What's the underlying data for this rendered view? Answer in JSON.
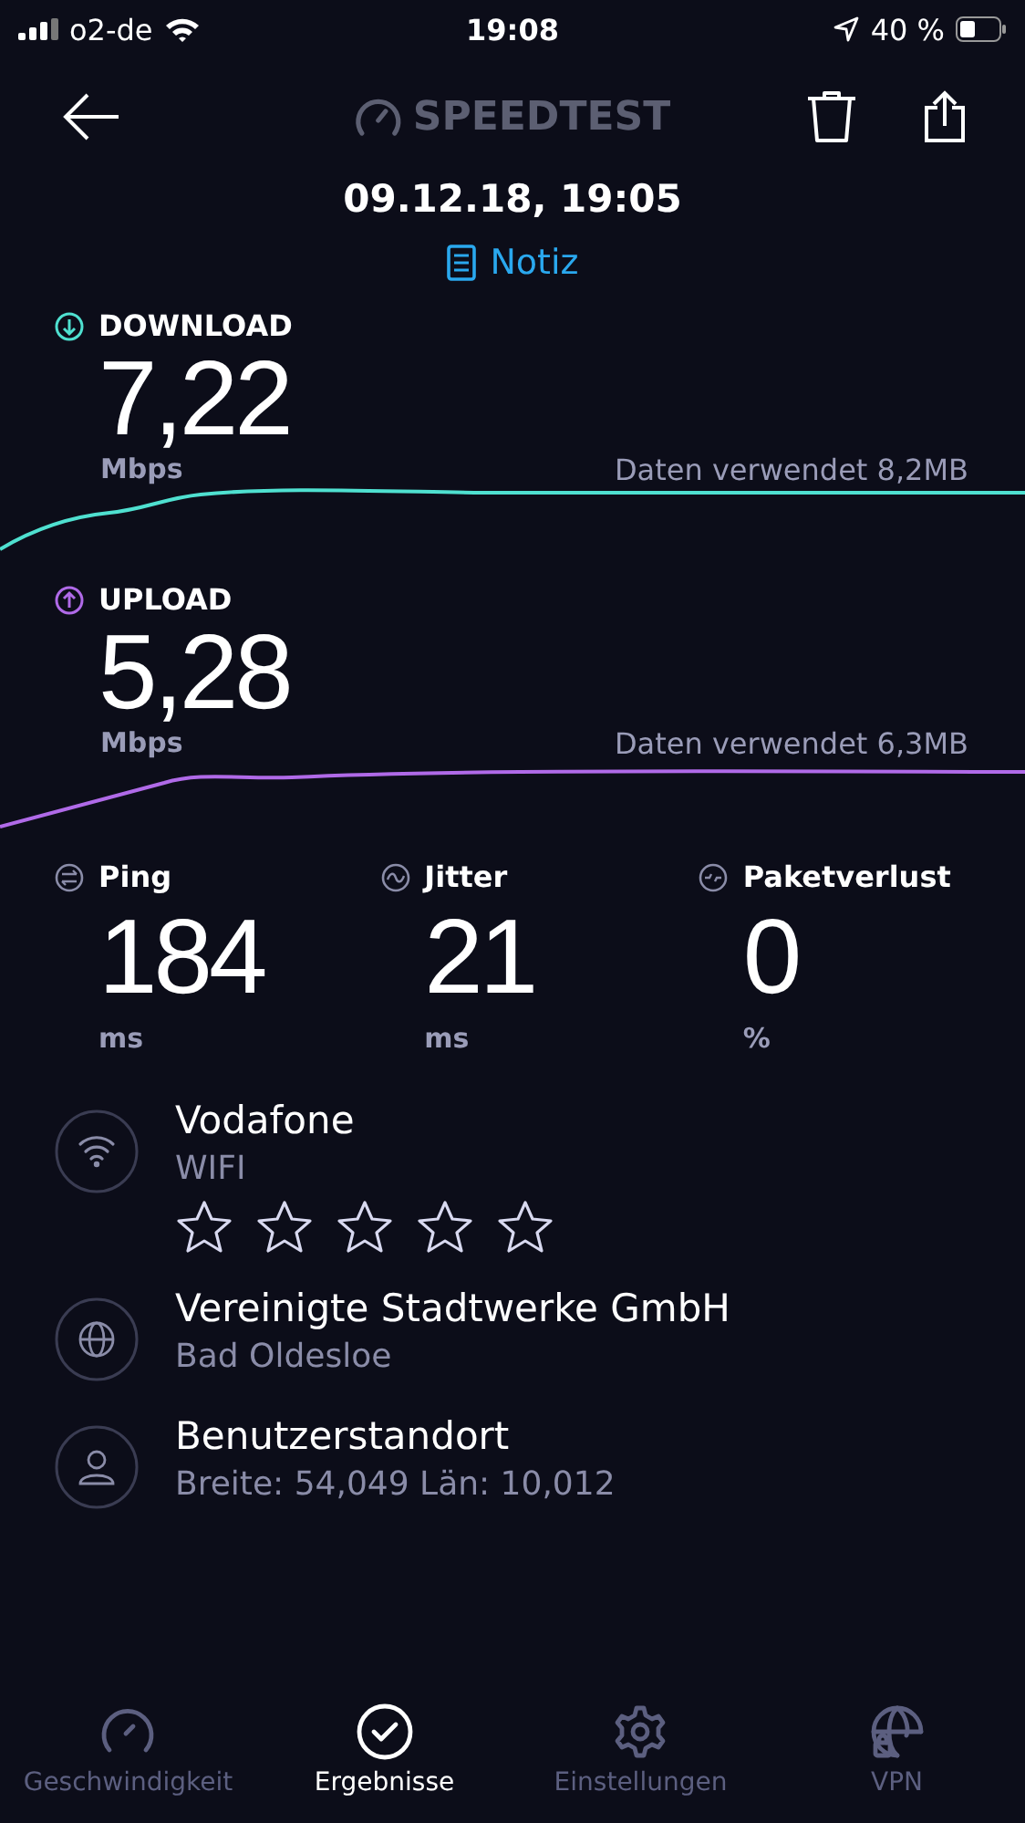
{
  "status_bar": {
    "carrier": "o2-de",
    "time": "19:08",
    "battery": "40 %"
  },
  "header": {
    "logo": "SPEEDTEST"
  },
  "result": {
    "date": "09.12.18, 19:05",
    "note": "Notiz"
  },
  "speeds": [
    {
      "kind": "download",
      "label": "DOWNLOAD",
      "value": "7,22",
      "unit": "Mbps",
      "data_used": "Daten verwendet 8,2MB",
      "color": "#4fe0d0"
    },
    {
      "kind": "upload",
      "label": "UPLOAD",
      "value": "5,28",
      "unit": "Mbps",
      "data_used": "Daten verwendet 6,3MB",
      "color": "#b06ae8"
    }
  ],
  "metrics": [
    {
      "kind": "ping",
      "label": "Ping",
      "value": "184",
      "unit": "ms"
    },
    {
      "kind": "jitter",
      "label": "Jitter",
      "value": "21",
      "unit": "ms"
    },
    {
      "kind": "loss",
      "label": "Paketverlust",
      "value": "0",
      "unit": "%"
    }
  ],
  "details": [
    {
      "kind": "wifi",
      "title": "Vodafone",
      "subtitle": "WIFI",
      "stars": 0
    },
    {
      "kind": "provider",
      "title": "Vereinigte Stadtwerke GmbH",
      "subtitle": "Bad Oldesloe"
    },
    {
      "kind": "location",
      "title": "Benutzerstandort",
      "subtitle": "Breite: 54,049  Län: 10,012"
    }
  ],
  "tabs": [
    {
      "kind": "speed",
      "label": "Geschwindigkeit",
      "selected": false
    },
    {
      "kind": "results",
      "label": "Ergebnisse",
      "selected": true
    },
    {
      "kind": "settings",
      "label": "Einstellungen",
      "selected": false
    },
    {
      "kind": "vpn",
      "label": "VPN",
      "selected": false
    }
  ]
}
